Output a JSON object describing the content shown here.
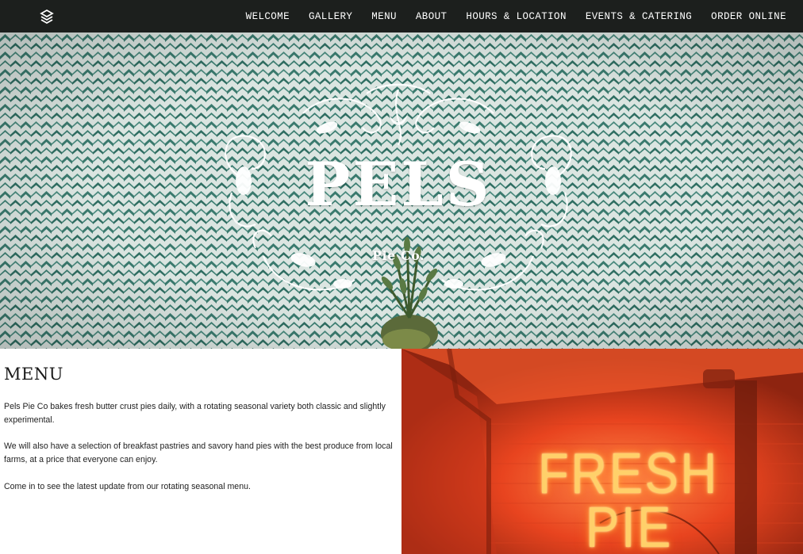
{
  "nav": {
    "logo_icon": "stacked-layers-logo-icon",
    "links": [
      "WELCOME",
      "GALLERY",
      "MENU",
      "ABOUT",
      "HOURS & LOCATION",
      "EVENTS & CATERING",
      "ORDER ONLINE"
    ]
  },
  "hero": {
    "title": "PELS",
    "subtitle": "Pie Co."
  },
  "menu": {
    "heading": "MENU",
    "paragraphs": [
      "Pels Pie Co bakes fresh butter crust pies daily, with a rotating seasonal variety both classic and slightly experimental.",
      "We will also have a selection of breakfast pastries and savory hand pies with the best produce from local farms, at a price that everyone can enjoy.",
      "Come in to see the latest update from our rotating seasonal menu."
    ]
  },
  "neon_sign": {
    "line1": "FRESH",
    "line2": "PIE"
  },
  "colors": {
    "nav_bg": "#1c1f1d",
    "pattern_teal": "#3a7a6e",
    "pattern_light": "#dbe5e1",
    "neon_red": "#e84020",
    "neon_glow": "#ffd06a"
  }
}
